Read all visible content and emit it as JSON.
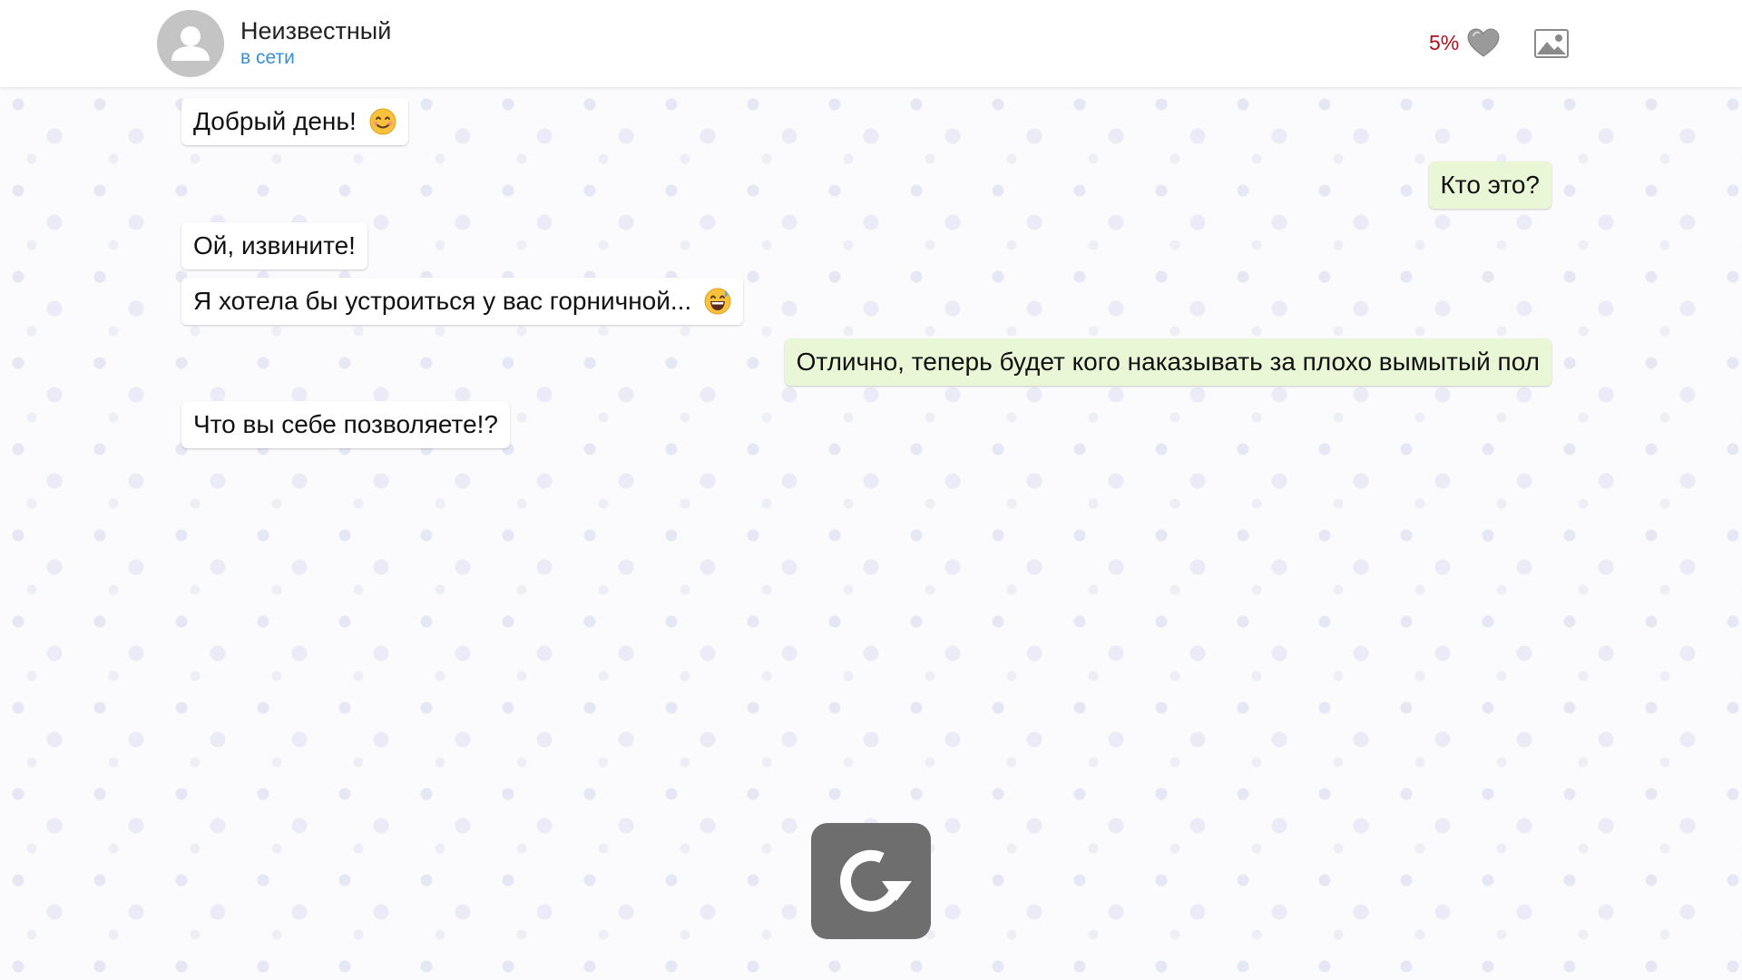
{
  "header": {
    "contact_name": "Неизвестный",
    "contact_status": "в сети",
    "affection_value": "5%",
    "avatar_icon": "user-silhouette-icon",
    "heart_icon": "heart-icon",
    "gallery_icon": "image-gallery-icon"
  },
  "messages": [
    {
      "side": "in",
      "text": "Добрый день!",
      "emoji": "smiling-face-icon"
    },
    {
      "side": "out",
      "text": "Кто это?"
    },
    {
      "side": "in",
      "text": "Ой, извините!"
    },
    {
      "side": "in",
      "text": "Я хотела бы устроиться у вас горничной...",
      "emoji": "grinning-sweat-face-icon"
    },
    {
      "side": "out",
      "text": "Отлично, теперь будет кого наказывать за плохо вымытый пол"
    },
    {
      "side": "in",
      "text": "Что вы себе позволяете!?"
    }
  ],
  "controls": {
    "reload_icon": "reload-icon"
  },
  "colors": {
    "incoming_bubble": "#ffffff",
    "outgoing_bubble": "#eaf7d6",
    "status_blue": "#3a8fd0",
    "affection_red": "#b0101c",
    "reload_bg": "#6e6e6e"
  }
}
